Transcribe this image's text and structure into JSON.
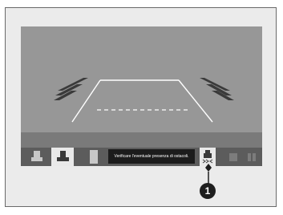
{
  "toolbar": {
    "buttons": [
      {
        "name": "normal-view",
        "icon": "car-normal-view-icon",
        "selected": false
      },
      {
        "name": "wide-view",
        "icon": "car-wide-view-icon",
        "selected": true
      },
      {
        "name": "top-down-view",
        "icon": "car-top-down-view-icon",
        "selected": false
      },
      {
        "name": "parking-sensor",
        "icon": "car-sensor-icon",
        "selected": false
      },
      {
        "name": "guideline-setting",
        "icon": "guideline-icon",
        "selected": false
      },
      {
        "name": "settings",
        "icon": "settings-icon",
        "selected": false
      }
    ],
    "message": "Verificare l'eventuale presenza di ostacoli."
  },
  "callout": {
    "label": "1"
  },
  "colors": {
    "frame_bg": "#ebebeb",
    "camera_bg": "#979797",
    "toolbar_bg": "#5c5c5c",
    "selected_bg": "#e9e9e9",
    "message_bg": "#1c1c1c",
    "guideline": "#ffffff",
    "sensor_marks": "#3a3a3a"
  }
}
